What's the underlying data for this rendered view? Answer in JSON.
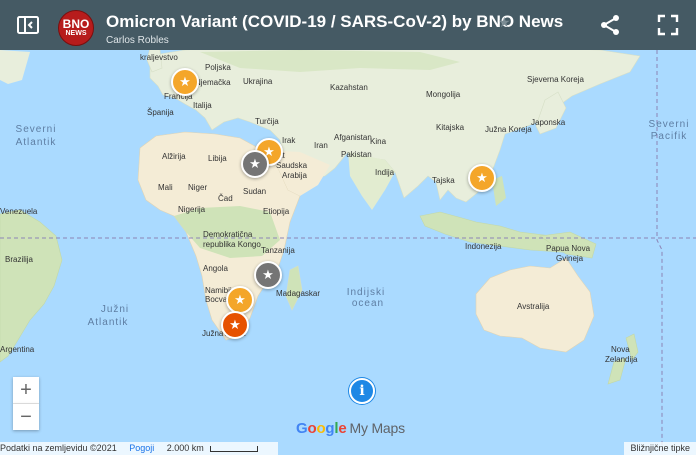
{
  "header": {
    "title": "Omicron Variant (COVID-19 / SARS-CoV-2) by BNO News",
    "author": "Carlos Robles",
    "logo_line1": "BNO",
    "logo_line2": "NEWS",
    "icons": [
      "sidebar-toggle-icon",
      "star-icon",
      "share-icon",
      "fullscreen-icon"
    ]
  },
  "map": {
    "labels": [
      {
        "text": "kraljevstvo",
        "cls": "country"
      },
      {
        "text": "Poljska",
        "cls": "country"
      },
      {
        "text": "Njemačka",
        "cls": "country"
      },
      {
        "text": "Ukrajina",
        "cls": "country"
      },
      {
        "text": "Kazahstan",
        "cls": "country"
      },
      {
        "text": "Mongolija",
        "cls": "country"
      },
      {
        "text": "Francija",
        "cls": "country"
      },
      {
        "text": "Italija",
        "cls": "country"
      },
      {
        "text": "Španija",
        "cls": "country"
      },
      {
        "text": "Turčija",
        "cls": "country"
      },
      {
        "text": "Sjeverna Koreja",
        "cls": "country"
      },
      {
        "text": "Irak",
        "cls": "country"
      },
      {
        "text": "Iran",
        "cls": "country"
      },
      {
        "text": "Afganistan",
        "cls": "country"
      },
      {
        "text": "Kina",
        "cls": "country"
      },
      {
        "text": "Kitajska",
        "cls": "country"
      },
      {
        "text": "Južna Koreja",
        "cls": "country"
      },
      {
        "text": "Japonska",
        "cls": "country"
      },
      {
        "text": "Alžirija",
        "cls": "country"
      },
      {
        "text": "Libija",
        "cls": "country"
      },
      {
        "text": "Egipat",
        "cls": "country"
      },
      {
        "text": "Pakistan",
        "cls": "country"
      },
      {
        "text": "Saudska",
        "cls": "country"
      },
      {
        "text": "Arabija",
        "cls": "country"
      },
      {
        "text": "Indija",
        "cls": "country"
      },
      {
        "text": "Mali",
        "cls": "country"
      },
      {
        "text": "Niger",
        "cls": "country"
      },
      {
        "text": "Čad",
        "cls": "country"
      },
      {
        "text": "Sudan",
        "cls": "country"
      },
      {
        "text": "Tajska",
        "cls": "country"
      },
      {
        "text": "Nigerija",
        "cls": "country"
      },
      {
        "text": "Etiopija",
        "cls": "country"
      },
      {
        "text": "Demokratična",
        "cls": "country"
      },
      {
        "text": "republika Kongo",
        "cls": "country"
      },
      {
        "text": "Tanzanija",
        "cls": "country"
      },
      {
        "text": "Indonezija",
        "cls": "country"
      },
      {
        "text": "Papua Nova",
        "cls": "country"
      },
      {
        "text": "Gvineja",
        "cls": "country"
      },
      {
        "text": "Angola",
        "cls": "country"
      },
      {
        "text": "Brazilija",
        "cls": "country"
      },
      {
        "text": "Namibija",
        "cls": "country"
      },
      {
        "text": "Madagaskar",
        "cls": "country"
      },
      {
        "text": "Bocvana",
        "cls": "country"
      },
      {
        "text": "Avstralija",
        "cls": "country"
      },
      {
        "text": "Južna Afrika",
        "cls": "country"
      },
      {
        "text": "Nova",
        "cls": "country"
      },
      {
        "text": "Zelandija",
        "cls": "country"
      },
      {
        "text": "Argentina",
        "cls": "country"
      },
      {
        "text": "Severni",
        "cls": "ocean"
      },
      {
        "text": "Atlantik",
        "cls": "ocean"
      },
      {
        "text": "Južni",
        "cls": "ocean"
      },
      {
        "text": "Atlantik",
        "cls": "ocean"
      },
      {
        "text": "Indijski",
        "cls": "ocean"
      },
      {
        "text": "ocean",
        "cls": "ocean"
      },
      {
        "text": "Severni",
        "cls": "ocean"
      },
      {
        "text": "Pacifik",
        "cls": "ocean"
      },
      {
        "text": "Venezuela",
        "cls": "country"
      }
    ],
    "markers": [
      {
        "name": "marker-uk",
        "color": "#f4a62a"
      },
      {
        "name": "marker-israel",
        "color": "#f4a62a"
      },
      {
        "name": "marker-egypt",
        "color": "#757575"
      },
      {
        "name": "marker-hong-kong",
        "color": "#f4a62a"
      },
      {
        "name": "marker-mozambique",
        "color": "#757575"
      },
      {
        "name": "marker-botswana",
        "color": "#f4a62a"
      },
      {
        "name": "marker-south-africa",
        "color": "#e65100"
      }
    ],
    "colors": {
      "water": "#aadaff",
      "land": "#e8eedc",
      "desert": "#f4ecd6",
      "forest": "#cfe3b8",
      "header": "#455a64",
      "marker": "#f4a62a"
    }
  },
  "controls": {
    "zoom_in": "+",
    "zoom_out": "−",
    "info": "i"
  },
  "branding": {
    "google": [
      "G",
      "o",
      "o",
      "g",
      "l",
      "e"
    ],
    "google_colors": [
      "#4285f4",
      "#ea4335",
      "#fbbc05",
      "#4285f4",
      "#34a853",
      "#ea4335"
    ],
    "my_maps": "My Maps"
  },
  "footer": {
    "map_data": "Podatki na zemljevidu ©2021",
    "terms": "Pogoji",
    "scale": "2.000 km",
    "shortcuts": "Bližnjične tipke"
  }
}
